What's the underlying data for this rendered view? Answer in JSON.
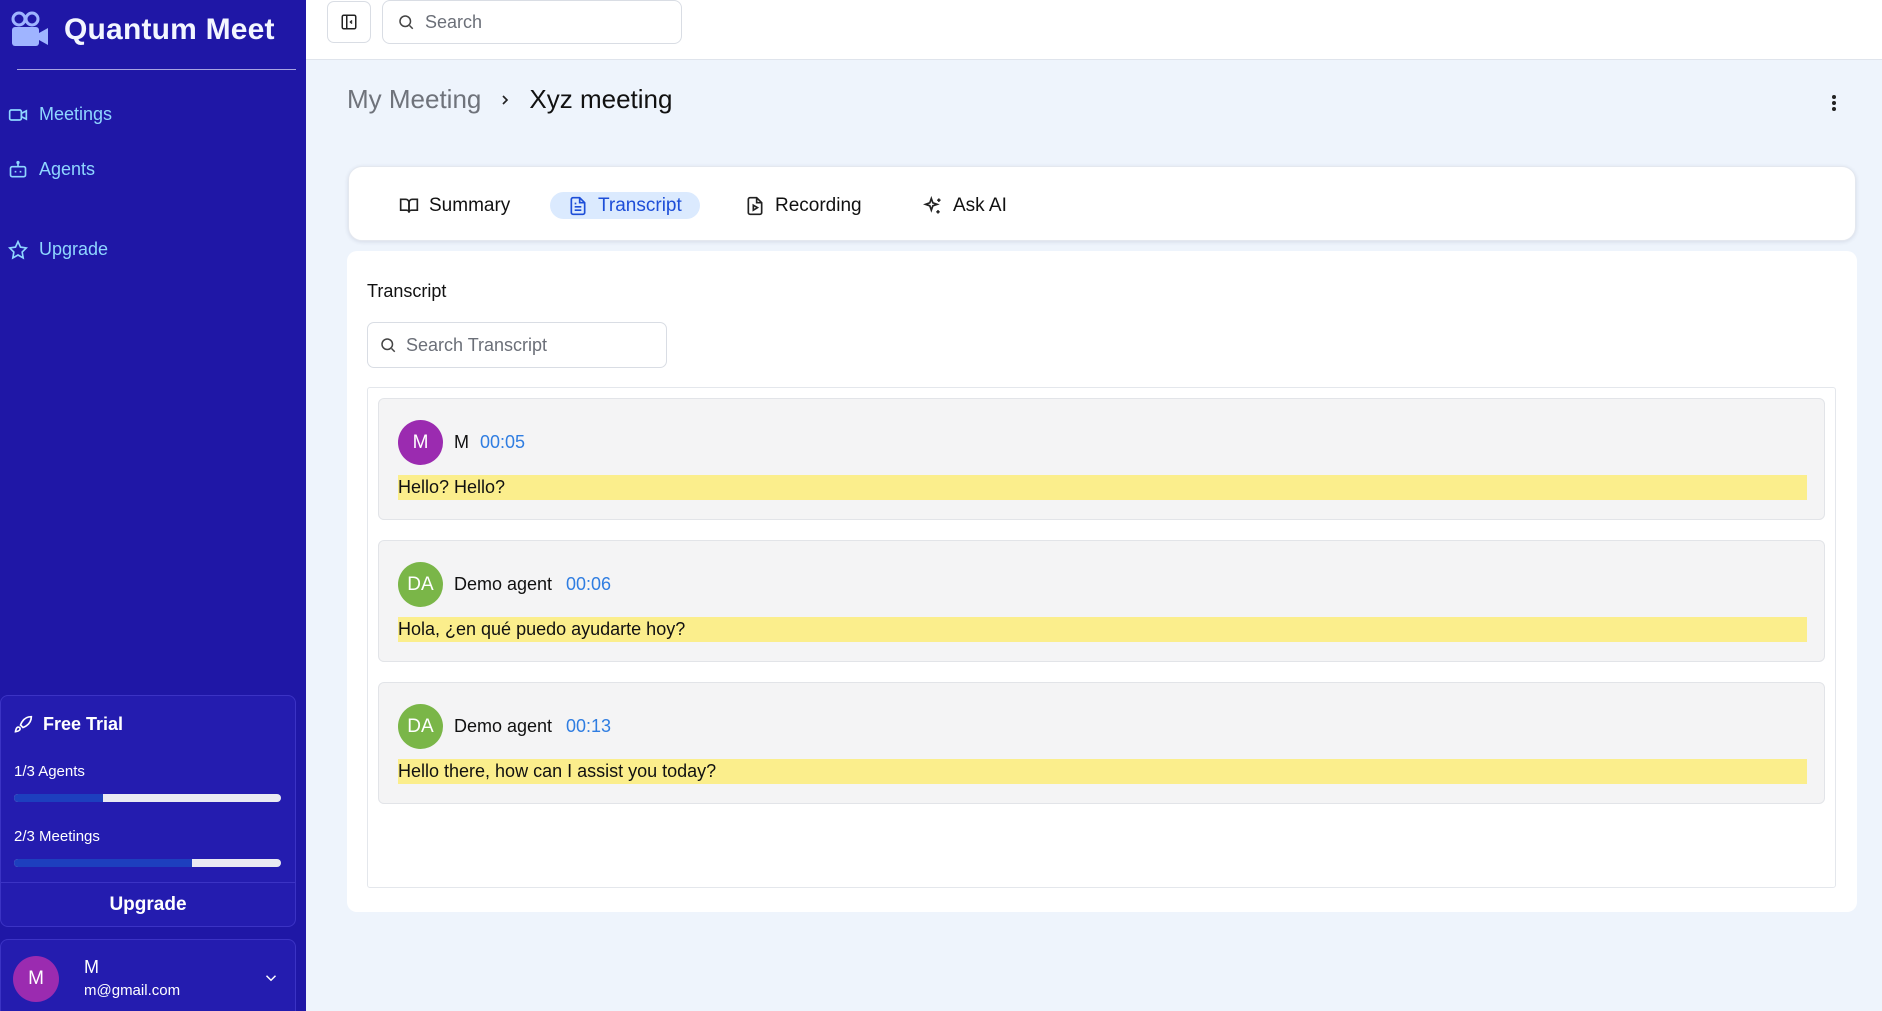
{
  "app": {
    "title": "Quantum Meet"
  },
  "sidebar": {
    "items": [
      {
        "label": "Meetings",
        "icon": "video-icon"
      },
      {
        "label": "Agents",
        "icon": "bot-icon"
      },
      {
        "label": "Upgrade",
        "icon": "star-icon"
      }
    ],
    "trial": {
      "title": "Free Trial",
      "icon": "rocket-icon",
      "agents_label": "1/3 Agents",
      "agents_progress": 0.333,
      "meetings_label": "2/3 Meetings",
      "meetings_progress": 0.667,
      "upgrade_label": "Upgrade"
    },
    "user": {
      "initial": "M",
      "name": "M",
      "email": "m@gmail.com"
    }
  },
  "topbar": {
    "search_placeholder": "Search"
  },
  "breadcrumb": {
    "parent": "My Meeting",
    "current": "Xyz meeting"
  },
  "tabs": [
    {
      "label": "Summary",
      "icon": "book-open-icon",
      "active": false
    },
    {
      "label": "Transcript",
      "icon": "file-text-icon",
      "active": true
    },
    {
      "label": "Recording",
      "icon": "file-video-icon",
      "active": false
    },
    {
      "label": "Ask AI",
      "icon": "sparkles-icon",
      "active": false
    }
  ],
  "transcript": {
    "title": "Transcript",
    "search_placeholder": "Search Transcript",
    "entries": [
      {
        "initials": "M",
        "speaker": "M",
        "time": "00:05",
        "text": "Hello? Hello?",
        "avatar_color": "#9b2bb0"
      },
      {
        "initials": "DA",
        "speaker": "Demo agent",
        "time": "00:06",
        "text": "Hola, ¿en qué puedo ayudarte hoy?",
        "avatar_color": "#7ab648"
      },
      {
        "initials": "DA",
        "speaker": "Demo agent",
        "time": "00:13",
        "text": "Hello there, how can I assist you today?",
        "avatar_color": "#7ab648"
      }
    ]
  },
  "colors": {
    "sidebar_bg": "#1f17a6",
    "nav_text": "#8fd6ff",
    "active_tab_bg": "#dbeafe",
    "active_tab_text": "#1d4ed8",
    "highlight": "#fbee8c",
    "timestamp": "#2f7de1"
  }
}
